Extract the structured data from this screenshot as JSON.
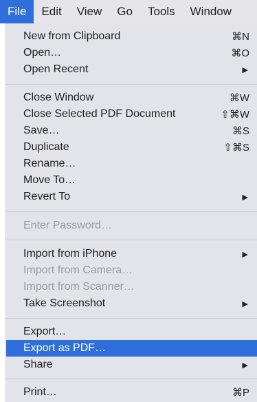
{
  "menubar": {
    "items": [
      {
        "label": "File",
        "active": true
      },
      {
        "label": "Edit"
      },
      {
        "label": "View"
      },
      {
        "label": "Go"
      },
      {
        "label": "Tools"
      },
      {
        "label": "Window"
      }
    ]
  },
  "menu": {
    "items": [
      {
        "label": "New from Clipboard",
        "shortcut": "⌘N"
      },
      {
        "label": "Open…",
        "shortcut": "⌘O"
      },
      {
        "label": "Open Recent",
        "submenu_arrow": "▶"
      },
      {
        "label": "Close Window",
        "shortcut": "⌘W"
      },
      {
        "label": "Close Selected PDF Document",
        "shortcut": "⇧⌘W"
      },
      {
        "label": "Save…",
        "shortcut": "⌘S"
      },
      {
        "label": "Duplicate",
        "shortcut": "⇧⌘S"
      },
      {
        "label": "Rename…"
      },
      {
        "label": "Move To…"
      },
      {
        "label": "Revert To",
        "submenu_arrow": "▶"
      },
      {
        "label": "Enter Password…",
        "disabled": true
      },
      {
        "label": "Import from iPhone",
        "submenu_arrow": "▶"
      },
      {
        "label": "Import from Camera…",
        "disabled": true
      },
      {
        "label": "Import from Scanner…",
        "disabled": true
      },
      {
        "label": "Take Screenshot",
        "submenu_arrow": "▶"
      },
      {
        "label": "Export…"
      },
      {
        "label": "Export as PDF…",
        "highlighted": true
      },
      {
        "label": "Share",
        "submenu_arrow": "▶"
      },
      {
        "label": "Print…",
        "shortcut": "⌘P"
      }
    ]
  },
  "colors": {
    "highlight": "#2f6fdb",
    "menu_background": "#e3e3ea",
    "disabled_text": "#9a9aa1"
  }
}
